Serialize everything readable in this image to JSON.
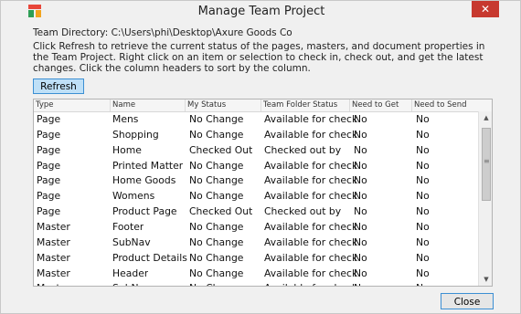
{
  "window": {
    "title": "Manage Team Project",
    "close_glyph": "✕"
  },
  "directory": "Team Directory: C:\\Users\\phi\\Desktop\\Axure Goods Co",
  "description": "Click Refresh to retrieve the current status of the pages, masters, and document properties in the Team Project. Right click on an item or selection to check in, check out, and get the latest changes. Click the column headers to sort by the column.",
  "buttons": {
    "refresh": "Refresh",
    "close": "Close"
  },
  "table": {
    "columns": [
      "Type",
      "Name",
      "My Status",
      "Team Folder Status",
      "Need to Get",
      "Need to Send"
    ],
    "rows": [
      [
        "Page",
        "Mens",
        "No Change",
        "Available for check",
        "No",
        "No"
      ],
      [
        "Page",
        "Shopping",
        "No Change",
        "Available for check",
        "No",
        "No"
      ],
      [
        "Page",
        "Home",
        "Checked Out",
        "Checked out by",
        "No",
        "No"
      ],
      [
        "Page",
        "Printed Matter",
        "No Change",
        "Available for check",
        "No",
        "No"
      ],
      [
        "Page",
        "Home Goods",
        "No Change",
        "Available for check",
        "No",
        "No"
      ],
      [
        "Page",
        "Womens",
        "No Change",
        "Available for check",
        "No",
        "No"
      ],
      [
        "Page",
        "Product Page",
        "Checked Out",
        "Checked out by",
        "No",
        "No"
      ],
      [
        "Master",
        "Footer",
        "No Change",
        "Available for check",
        "No",
        "No"
      ],
      [
        "Master",
        "SubNav",
        "No Change",
        "Available for check",
        "No",
        "No"
      ],
      [
        "Master",
        "Product Details",
        "No Change",
        "Available for check",
        "No",
        "No"
      ],
      [
        "Master",
        "Header",
        "No Change",
        "Available for check",
        "No",
        "No"
      ],
      [
        "Master",
        "SubNav",
        "No Change",
        "Available for check",
        "No",
        "No"
      ]
    ]
  },
  "scrollbar": {
    "up": "▲",
    "down": "▼",
    "grip": "≡"
  }
}
